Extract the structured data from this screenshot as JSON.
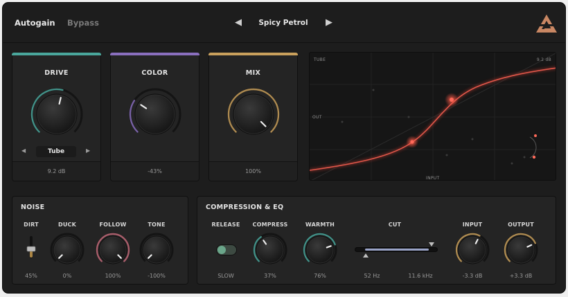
{
  "header": {
    "autogain": "Autogain",
    "bypass": "Bypass",
    "preset_name": "Spicy Petrol",
    "prev_arrow": "◀",
    "next_arrow": "▶"
  },
  "drive": {
    "title": "DRIVE",
    "mode": "Tube",
    "value": "9.2 dB",
    "level": 0.55,
    "arrow_left": "◀",
    "arrow_right": "▶"
  },
  "color": {
    "title": "COLOR",
    "value": "-43%",
    "level": 0.29
  },
  "mix": {
    "title": "MIX",
    "value": "100%",
    "level": 1.0
  },
  "graph": {
    "top_left": "TUBE",
    "top_right": "9.2 dB",
    "left": "OUT",
    "bottom": "INPUT"
  },
  "noise": {
    "title": "NOISE",
    "dirt": {
      "label": "DIRT",
      "value": "45%",
      "level": 0.45
    },
    "duck": {
      "label": "DUCK",
      "value": "0%",
      "level": 0.0
    },
    "follow": {
      "label": "FOLLOW",
      "value": "100%",
      "level": 1.0
    },
    "tone": {
      "label": "TONE",
      "value": "-100%",
      "level": 0.0
    }
  },
  "comp": {
    "title": "COMPRESSION & EQ",
    "release": {
      "label": "RELEASE",
      "value": "SLOW"
    },
    "compress": {
      "label": "COMPRESS",
      "value": "37%",
      "level": 0.37
    },
    "warmth": {
      "label": "WARMTH",
      "value": "76%",
      "level": 0.76
    },
    "cut": {
      "label": "CUT",
      "low": "52 Hz",
      "high": "11.6 kHz"
    },
    "input": {
      "label": "INPUT",
      "value": "-3.3 dB",
      "level": 0.6
    },
    "output": {
      "label": "OUTPUT",
      "value": "+3.3 dB",
      "level": 0.74
    }
  },
  "colors": {
    "drive": "#4aa79c",
    "color": "#8a6fbe",
    "mix": "#c9a05c",
    "noise": "#c26b7a",
    "curve": "#d9483a"
  }
}
